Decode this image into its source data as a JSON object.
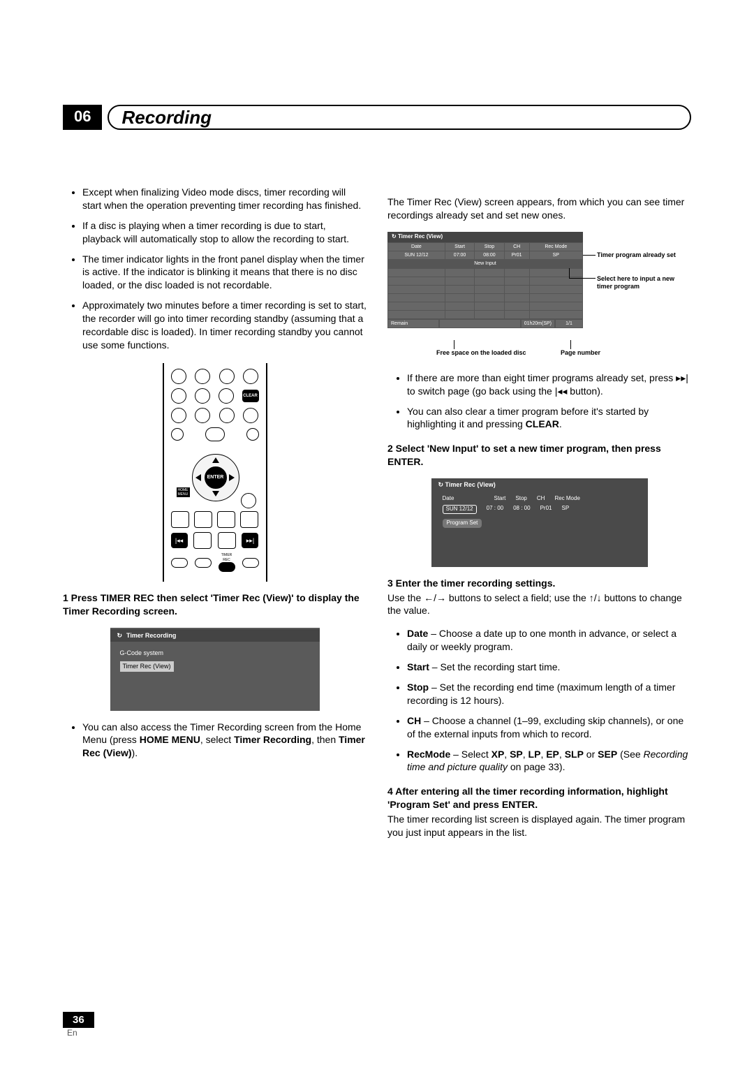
{
  "chapter_num": "06",
  "chapter_title": "Recording",
  "left": {
    "bullets": [
      "Except when finalizing Video mode discs, timer recording will start when the operation preventing timer recording has finished.",
      "If a disc is playing when a timer recording is due to start, playback will automatically stop to allow the recording to start.",
      "The timer indicator lights in the front panel display when the timer is active. If the indicator is blinking it means that there is no disc loaded, or the disc loaded is not recordable.",
      "Approximately two minutes before a timer recording is set to start, the recorder will go into timer recording standby (assuming that a recordable disc is loaded). In timer recording standby you cannot use some functions."
    ],
    "remote": {
      "clear": "CLEAR",
      "enter": "ENTER",
      "home_menu": "HOME MENU",
      "timer_rec": "TIMER REC"
    },
    "step1_bold": "1    Press TIMER REC then select 'Timer Rec (View)' to display the Timer Recording screen.",
    "osd1": {
      "title": "Timer Recording",
      "item1": "G-Code system",
      "item2": "Timer Rec (View)"
    },
    "access_note_pre": "You can also access the Timer Recording screen from the Home Menu (press ",
    "access_note_b1": "HOME MENU",
    "access_note_mid": ", select ",
    "access_note_b2": "Timer Recording",
    "access_note_mid2": ", then ",
    "access_note_b3": "Timer Rec (View)",
    "access_note_end": ")."
  },
  "right": {
    "intro": "The Timer Rec (View) screen appears, from which you can see timer recordings already set and set new ones.",
    "view": {
      "title": "Timer Rec (View)",
      "headers": [
        "Date",
        "Start",
        "Stop",
        "CH",
        "Rec Mode"
      ],
      "row": [
        "SUN 12/12",
        "07:00",
        "08:00",
        "Pr01",
        "SP"
      ],
      "new_input": "New Input",
      "remain": "Remain",
      "remain_val": "01h20m(SP)",
      "page": "1/1"
    },
    "callouts": {
      "program_set": "Timer program already set",
      "select_here": "Select here to input a new timer program",
      "page_number": "Page number",
      "free_space": "Free space on the loaded disc"
    },
    "bullets2_a1": "If there are more than eight timer programs already set, press ",
    "bullets2_a2": " to switch page (go back using the ",
    "bullets2_a3": " button).",
    "bullets2_b1": "You can also clear a timer program before it's started by highlighting it and pressing ",
    "bullets2_b2": "CLEAR",
    "bullets2_b3": ".",
    "step2": "2    Select 'New Input' to set a new timer program, then press ENTER.",
    "osd2": {
      "title": "Timer Rec (View)",
      "headers": [
        "Date",
        "Start",
        "Stop",
        "CH",
        "Rec Mode"
      ],
      "row": [
        "SUN 12/12",
        "07  :  00",
        "08  :  00",
        "Pr01",
        "SP"
      ],
      "program_set": "Program Set"
    },
    "step3": "3    Enter the timer recording settings.",
    "step3_use_a": "Use the ",
    "step3_use_b": " buttons to select a field; use the ",
    "step3_use_c": " buttons to change the value.",
    "settings": [
      {
        "b": "Date",
        "t": " – Choose a date up to one month in advance, or select a daily or weekly program."
      },
      {
        "b": "Start",
        "t": " – Set the recording start time."
      },
      {
        "b": "Stop",
        "t": " – Set the recording end time (maximum length of a timer recording is 12 hours)."
      },
      {
        "b": "CH",
        "t": " – Choose a channel (1–99, excluding skip channels), or one of the external inputs from which to record."
      }
    ],
    "recmode_b": "RecMode",
    "recmode_t1": " – Select ",
    "recmode_opts": [
      "XP",
      "SP",
      "LP",
      "EP",
      "SLP",
      "SEP"
    ],
    "recmode_t2": " (See ",
    "recmode_i": "Recording time and picture quality",
    "recmode_t3": " on page 33).",
    "step4": "4    After entering all the timer recording information, highlight 'Program Set' and press ENTER.",
    "step4_after": "The timer recording list screen is displayed again. The timer program you just input appears in the list."
  },
  "page_number": "36",
  "lang": "En"
}
